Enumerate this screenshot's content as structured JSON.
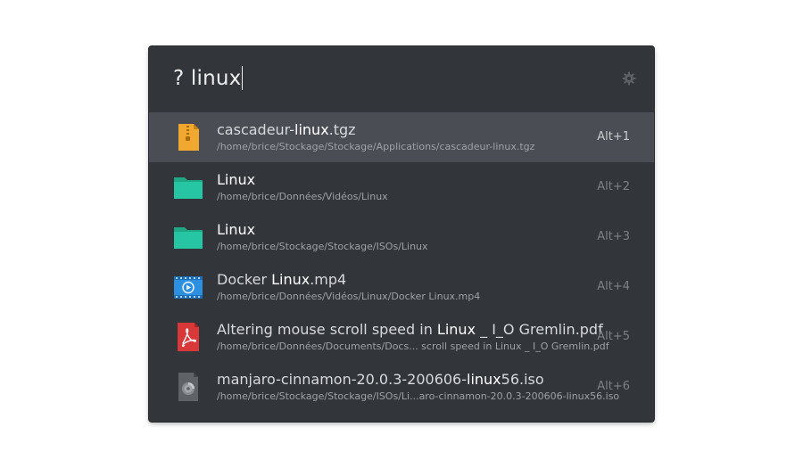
{
  "search": {
    "query": "? linux"
  },
  "icons": {
    "settings": "gear-icon"
  },
  "results": [
    {
      "icon": "archive-icon",
      "title_parts": [
        "cascadeur-",
        "linux",
        ".tgz"
      ],
      "path": "/home/brice/Stockage/Stockage/Applications/cascadeur-linux.tgz",
      "shortcut": "Alt+1"
    },
    {
      "icon": "folder-icon",
      "title_parts": [
        "",
        "Linux",
        ""
      ],
      "path": "/home/brice/Données/Vidéos/Linux",
      "shortcut": "Alt+2"
    },
    {
      "icon": "folder-icon",
      "title_parts": [
        "",
        "Linux",
        ""
      ],
      "path": "/home/brice/Stockage/Stockage/ISOs/Linux",
      "shortcut": "Alt+3"
    },
    {
      "icon": "video-file-icon",
      "title_parts": [
        "Docker ",
        "Linux",
        ".mp4"
      ],
      "path": "/home/brice/Données/Vidéos/Linux/Docker Linux.mp4",
      "shortcut": "Alt+4"
    },
    {
      "icon": "pdf-file-icon",
      "title_parts": [
        "Altering mouse scroll speed in ",
        "Linux",
        " _ I_O Gremlin.pdf"
      ],
      "path": "/home/brice/Données/Documents/Docs... scroll speed in Linux _ I_O Gremlin.pdf",
      "shortcut": "Alt+5"
    },
    {
      "icon": "disc-image-icon",
      "title_parts": [
        "manjaro-cinnamon-20.0.3-200606-",
        "linux",
        "56.iso"
      ],
      "path": "/home/brice/Stockage/Stockage/ISOs/Li...aro-cinnamon-20.0.3-200606-linux56.iso",
      "shortcut": "Alt+6"
    }
  ],
  "colors": {
    "background": "#32353a",
    "selected_row": "#4a4e54",
    "folder": "#26c6a4",
    "archive": "#f0a830",
    "video": "#2d8fe0",
    "pdf": "#d93838",
    "disc": "#5f6368"
  }
}
